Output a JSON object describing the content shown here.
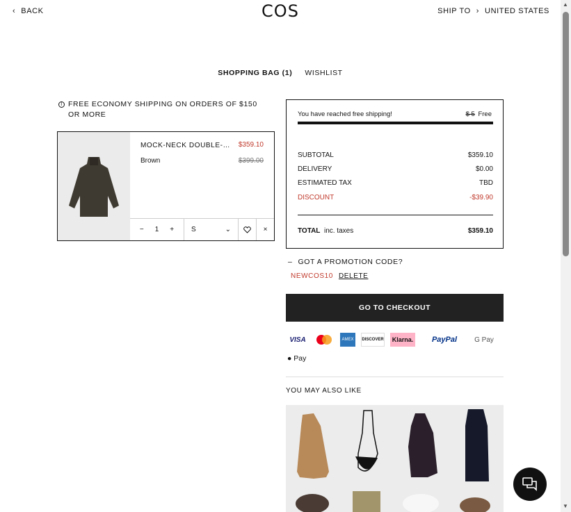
{
  "header": {
    "back_label": "BACK",
    "logo": "COS",
    "ship_to_label": "SHIP TO",
    "country": "UNITED STATES"
  },
  "tabs": {
    "bag": "SHOPPING BAG (1)",
    "wishlist": "WISHLIST"
  },
  "notice": {
    "free_shipping": "FREE ECONOMY SHIPPING ON ORDERS OF $150 OR MORE"
  },
  "item": {
    "name": "MOCK-NECK DOUBLE-FACED WOOL COAT",
    "price": "$359.10",
    "color": "Brown",
    "original_price": "$399.00",
    "quantity": "1",
    "size": "S",
    "minus": "−",
    "plus": "+",
    "remove": "×"
  },
  "summary": {
    "free_shipping_text": "You have reached free shipping!",
    "old_shipping": "$ 5",
    "free_label": "Free",
    "rows": [
      {
        "label": "SUBTOTAL",
        "value": "$359.10"
      },
      {
        "label": "DELIVERY",
        "value": "$0.00"
      },
      {
        "label": "ESTIMATED TAX",
        "value": "TBD"
      },
      {
        "label": "DISCOUNT",
        "value": "-$39.90"
      }
    ],
    "total_label": "TOTAL",
    "total_note": "inc. taxes",
    "total_value": "$359.10"
  },
  "promo": {
    "toggle": "–",
    "label": "GOT A PROMOTION CODE?",
    "code": "NEWCOS10",
    "delete": "DELETE"
  },
  "checkout_label": "GO TO CHECKOUT",
  "payments": {
    "visa": "VISA",
    "amex": "AMEX",
    "discover": "DISCOVER",
    "klarna": "Klarna.",
    "paypal": "PayPal",
    "gpay": "G Pay",
    "apple_pay": "Pay"
  },
  "recommendations": {
    "title": "YOU MAY ALSO LIKE"
  },
  "colors": {
    "accent_red": "#c0392b",
    "checkout_bg": "#222222"
  }
}
